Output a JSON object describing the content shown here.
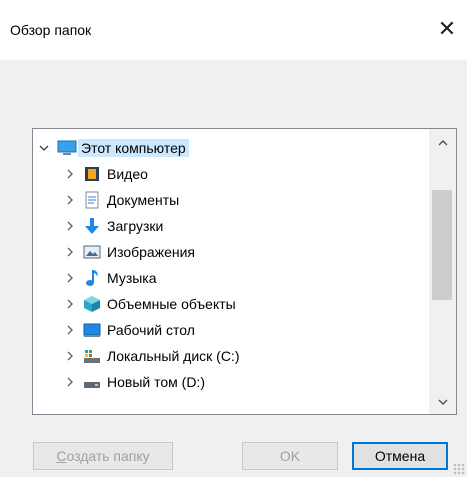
{
  "window": {
    "title": "Обзор папок",
    "close_glyph": "✕"
  },
  "tree": {
    "root": {
      "label": "Этот компьютер",
      "icon": "computer-icon",
      "expanded": true,
      "selected": true
    },
    "items": [
      {
        "label": "Видео",
        "icon": "video-icon"
      },
      {
        "label": "Документы",
        "icon": "documents-icon"
      },
      {
        "label": "Загрузки",
        "icon": "downloads-icon"
      },
      {
        "label": "Изображения",
        "icon": "pictures-icon"
      },
      {
        "label": "Музыка",
        "icon": "music-icon"
      },
      {
        "label": "Объемные объекты",
        "icon": "3d-objects-icon"
      },
      {
        "label": "Рабочий стол",
        "icon": "desktop-icon"
      },
      {
        "label": "Локальный диск (C:)",
        "icon": "local-disk-icon"
      },
      {
        "label": "Новый том (D:)",
        "icon": "drive-icon"
      }
    ]
  },
  "buttons": {
    "new_folder_prefix": "С",
    "new_folder_rest": "оздать папку",
    "ok": "OK",
    "cancel": "Отмена"
  },
  "colors": {
    "selection": "#cce8ff",
    "accent": "#0078d7",
    "folder_blue": "#1e88e5"
  }
}
